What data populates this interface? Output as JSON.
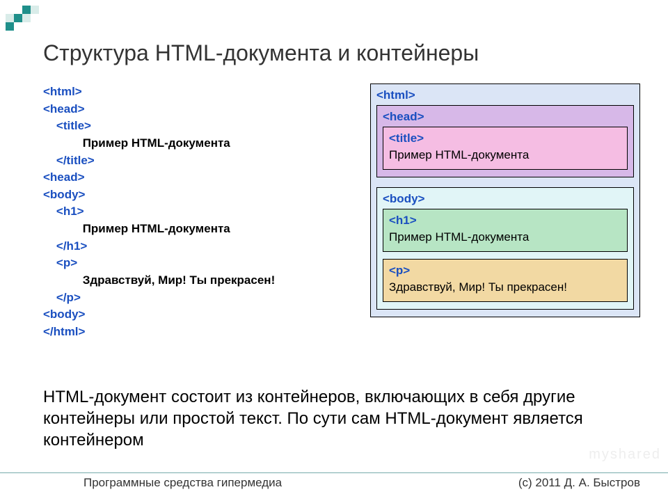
{
  "title": "Структура HTML-документа и контейнеры",
  "code": {
    "html_open": "<html>",
    "head_open": "<head>",
    "title_open": "<title>",
    "title_text": "Пример HTML-документа",
    "title_close": "</title>",
    "head_close": "<head>",
    "body_open": "<body>",
    "h1_open": "<h1>",
    "h1_text": "Пример HTML-документа",
    "h1_close": "</h1>",
    "p_open": "<p>",
    "p_text": "Здравствуй, Мир! Ты прекрасен!",
    "p_close": "</p>",
    "body_close": "<body>",
    "html_close": "</html>"
  },
  "diagram": {
    "html_label": "<html>",
    "head_label": "<head>",
    "title_label": "<title>",
    "title_text": "Пример HTML-документа",
    "body_label": "<body>",
    "h1_label": "<h1>",
    "h1_text": "Пример HTML-документа",
    "p_label": "<p>",
    "p_text": "Здравствуй, Мир! Ты прекрасен!"
  },
  "paragraph": "HTML-документ состоит из контейнеров, включающих в себя другие контейнеры или простой текст. По сути сам HTML-документ является контейнером",
  "footer": {
    "left": "Программные средства гипермедиа",
    "right": "(с) 2011    Д. А. Быстров"
  },
  "watermark": "myshared"
}
